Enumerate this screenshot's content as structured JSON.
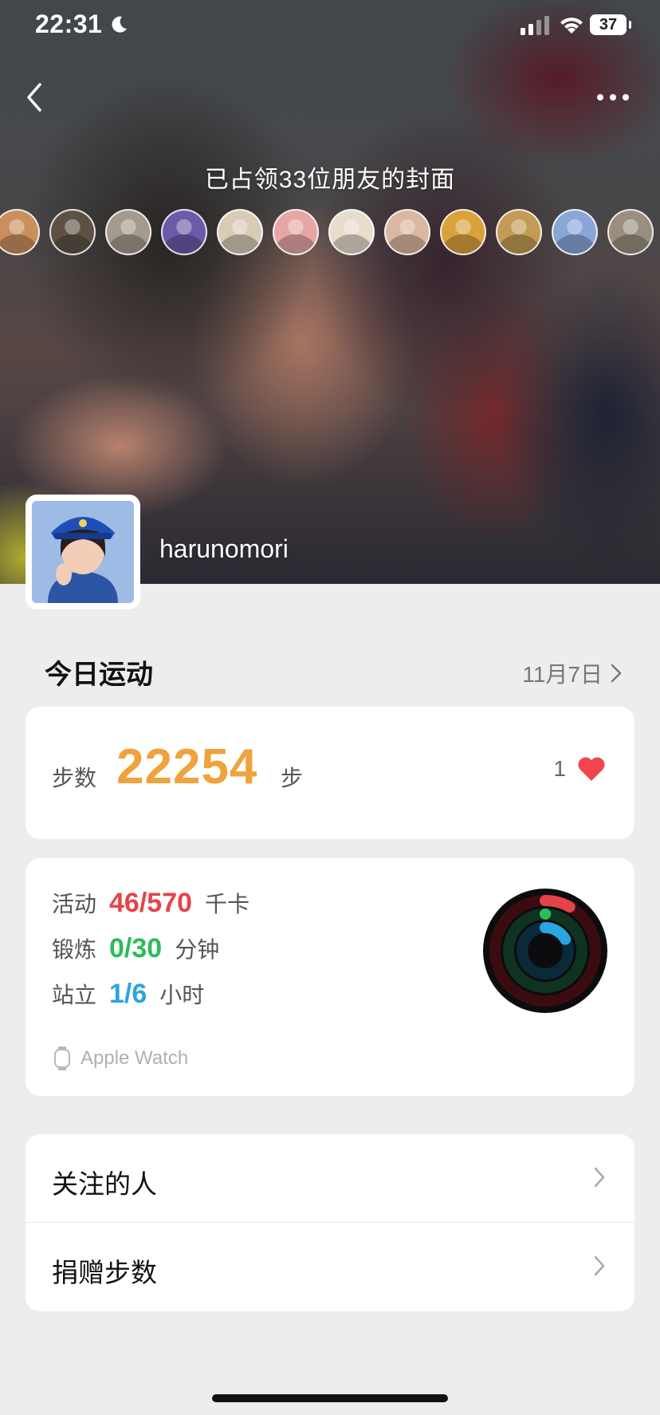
{
  "status_bar": {
    "time": "22:31",
    "battery": "37"
  },
  "cover": {
    "text": "已占领33位朋友的封面"
  },
  "friends": [
    {
      "color": "#c98f5c"
    },
    {
      "color": "#5d5145"
    },
    {
      "color": "#a59a8e"
    },
    {
      "color": "#6c5aa8"
    },
    {
      "color": "#d8cbb8"
    },
    {
      "color": "#e7a6a6"
    },
    {
      "color": "#e8dccd"
    },
    {
      "color": "#d9b7a0"
    },
    {
      "color": "#d9a23c"
    },
    {
      "color": "#c39b56"
    },
    {
      "color": "#8aa6d8"
    },
    {
      "color": "#9a8f7e"
    }
  ],
  "profile": {
    "username": "harunomori"
  },
  "today": {
    "title": "今日运动",
    "date": "11月7日"
  },
  "steps": {
    "label": "步数",
    "value": "22254",
    "unit": "步",
    "likes": "1"
  },
  "activity": {
    "move": {
      "label": "活动",
      "value": "46/570",
      "unit": "千卡",
      "color": "#e5434b",
      "fraction": 0.081
    },
    "exercise": {
      "label": "锻炼",
      "value": "0/30",
      "unit": "分钟",
      "color": "#2dbb5b",
      "fraction": 0.0
    },
    "stand": {
      "label": "站立",
      "value": "1/6",
      "unit": "小时",
      "color": "#2aa5e0",
      "fraction": 0.167
    },
    "source": "Apple Watch"
  },
  "menu": [
    {
      "label": "关注的人"
    },
    {
      "label": "捐赠步数"
    }
  ]
}
